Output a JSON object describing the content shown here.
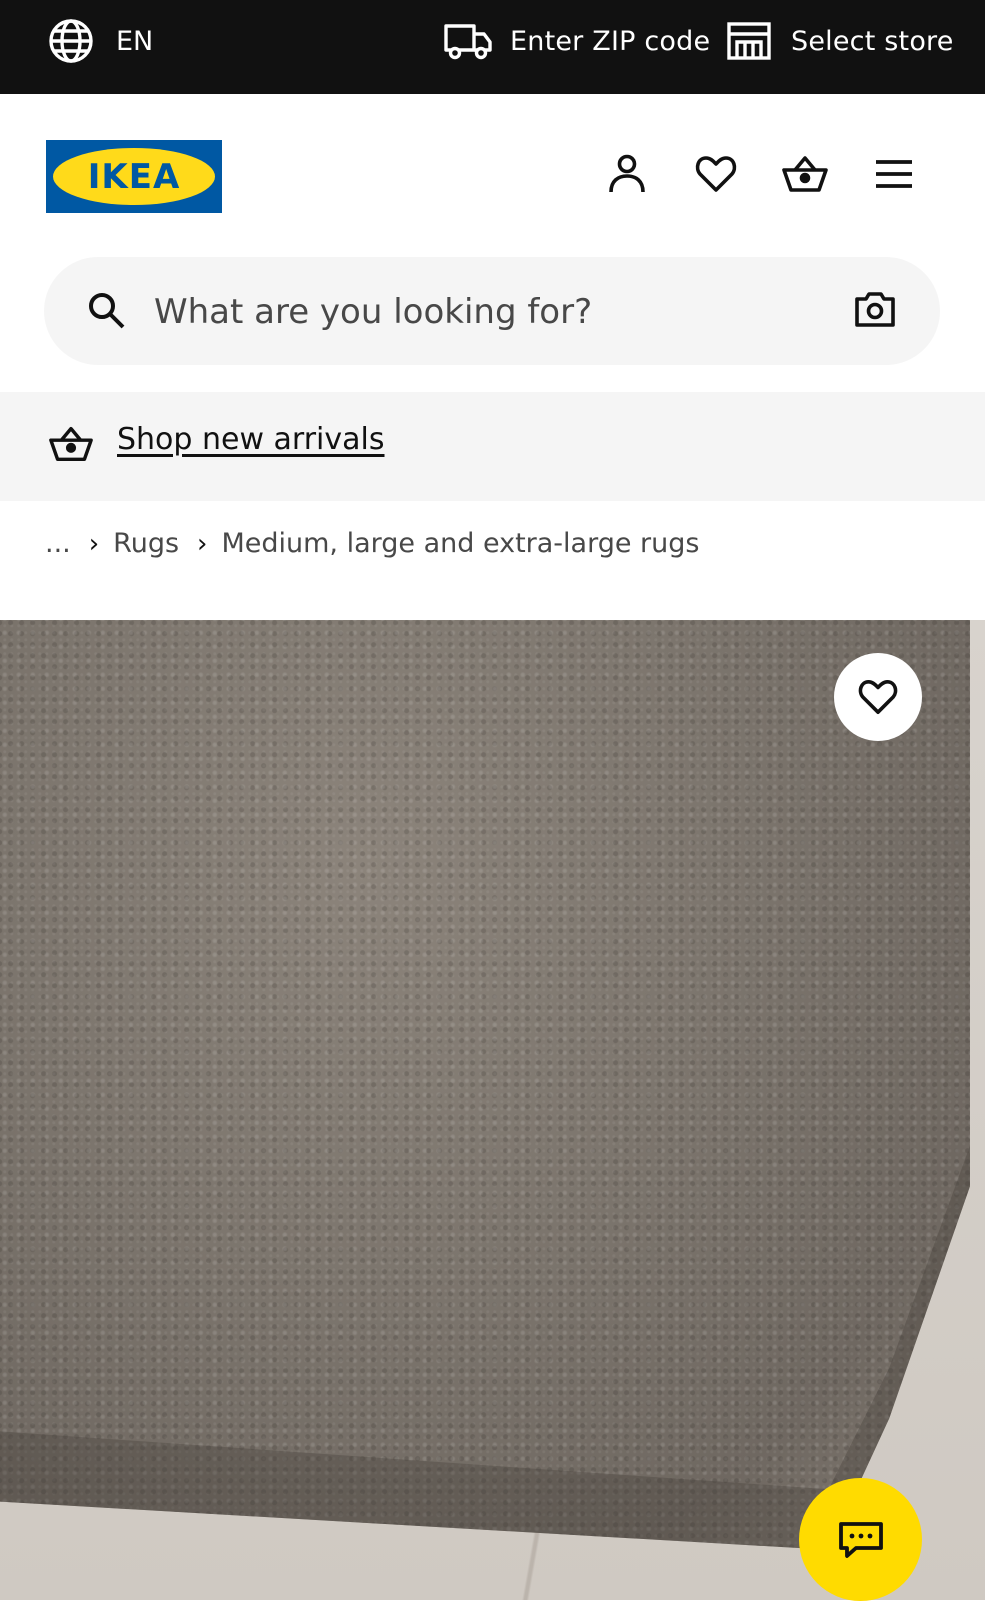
{
  "top_bar": {
    "language": "EN",
    "zip_label": "Enter ZIP code",
    "store_label": "Select store"
  },
  "header": {
    "logo_text": "IKEA",
    "icons": [
      "account-icon",
      "favorites-icon",
      "cart-icon",
      "menu-icon"
    ]
  },
  "search": {
    "placeholder": "What are you looking for?"
  },
  "promo": {
    "link_text": "Shop new arrivals"
  },
  "breadcrumb": {
    "items": [
      "...",
      "Rugs",
      "Medium, large and extra-large rugs"
    ]
  },
  "colors": {
    "top_bar_bg": "#111111",
    "brand_blue": "#0058a3",
    "brand_yellow": "#ffda1a",
    "chat_button": "#ffdb00"
  }
}
